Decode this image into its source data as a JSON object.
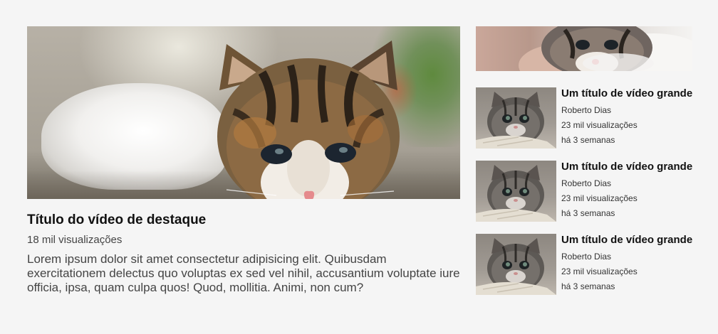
{
  "featured": {
    "title": "Título do vídeo de destaque",
    "views": "18 mil visualizações",
    "description": "Lorem ipsum dolor sit amet consectetur adipisicing elit. Quibusdam exercitationem delectus quo voluptas ex sed vel nihil, accusantium voluptate iure officia, ipsa, quam culpa quos! Quod, mollitia. Animi, non cum?"
  },
  "videos": [
    {
      "title": "Um título de vídeo grande",
      "channel": "Roberto Dias",
      "views": "23 mil visualizações",
      "age": "há 3 semanas"
    },
    {
      "title": "Um título de vídeo grande",
      "channel": "Roberto Dias",
      "views": "23 mil visualizações",
      "age": "há 3 semanas"
    },
    {
      "title": "Um título de vídeo grande",
      "channel": "Roberto Dias",
      "views": "23 mil visualizações",
      "age": "há 3 semanas"
    }
  ],
  "colors": {
    "background": "#f5f5f5",
    "title_text": "#111111",
    "body_text": "#444444"
  }
}
